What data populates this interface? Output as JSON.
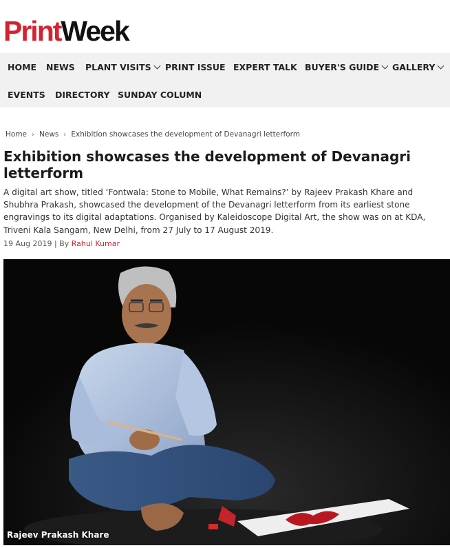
{
  "brand": {
    "logo_part1": "Print",
    "logo_part2": "Week"
  },
  "nav": {
    "row1": [
      {
        "label": "HOME"
      },
      {
        "label": "NEWS"
      },
      {
        "label": "PLANT VISITS"
      },
      {
        "label": "PRINT ISSUE"
      },
      {
        "label": "EXPERT TALK"
      },
      {
        "label": "BUYER'S GUIDE"
      },
      {
        "label": "GALLERY"
      }
    ],
    "row2": [
      {
        "label": "EVENTS"
      },
      {
        "label": "DIRECTORY"
      },
      {
        "label": "SUNDAY COLUMN"
      }
    ]
  },
  "breadcrumb": {
    "home": "Home",
    "news": "News",
    "current": "Exhibition showcases the development of Devanagri letterform",
    "separator": "›"
  },
  "article": {
    "title": "Exhibition showcases the development of Devanagri letterform",
    "summary": "A digital art show, titled ‘Fontwala: Stone to Mobile, What Remains?’ by Rajeev Prakash Khare and Shubhra Prakash, showcased the development of the Devanagri letterform from its earliest stone engravings to its digital adaptations. Organised by Kaleidoscope Digital Art, the show was on at KDA, Triveni Kala Sangam, New Delhi, from 27 July to 17 August 2019.",
    "date": "19 Aug 2019",
    "by_label": "| By",
    "author": "Rahul Kumar",
    "image_caption": "Rajeev Prakash Khare"
  },
  "colors": {
    "brand_red": "#d62230",
    "nav_bg": "#f1f1f1",
    "link_red": "#d62230"
  }
}
